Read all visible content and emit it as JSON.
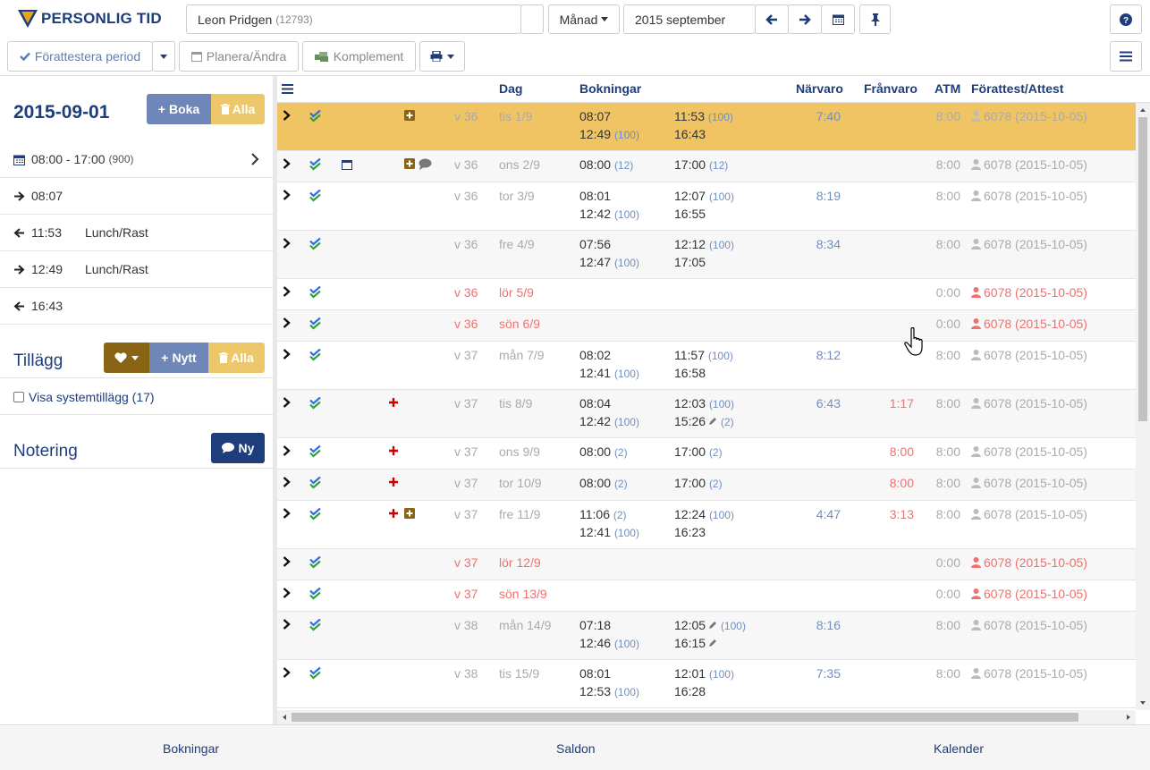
{
  "app": {
    "title": "PERSONLIG TID"
  },
  "toolbar": {
    "employee_name": "Leon Pridgen",
    "employee_id": "(12793)",
    "period_mode": "Månad",
    "period_value": "2015 september",
    "pre_attest_label": "Förattestera period",
    "plan_label": "Planera/Ändra",
    "complement_label": "Komplement"
  },
  "left": {
    "date": "2015-09-01",
    "book_label": "Boka",
    "all_label": "Alla",
    "schedule": "08:00 - 17:00",
    "schedule_code": "(900)",
    "punches": [
      {
        "dir": "in",
        "time": "08:07",
        "note": ""
      },
      {
        "dir": "out",
        "time": "11:53",
        "note": "Lunch/Rast"
      },
      {
        "dir": "in",
        "time": "12:49",
        "note": "Lunch/Rast"
      },
      {
        "dir": "out",
        "time": "16:43",
        "note": ""
      }
    ],
    "additions_title": "Tillägg",
    "new_label": "Nytt",
    "all_label2": "Alla",
    "show_system": "Visa systemtillägg (17)",
    "note_title": "Notering",
    "note_new": "Ny"
  },
  "grid": {
    "headers": [
      "Dag",
      "Bokningar",
      "Närvaro",
      "Frånvaro",
      "ATM",
      "Förattest/Attest"
    ],
    "rows": [
      {
        "week": "v 36",
        "day": "tis 1/9",
        "b1a": "08:07",
        "b1b": "",
        "b2a": "11:53",
        "b2b": "(100)",
        "b3a": "12:49",
        "b3b": "(100)",
        "b4a": "16:43",
        "b4b": "",
        "present": "7:40",
        "absent": "",
        "atm": "8:00",
        "attest": "6078 (2015-10-05)",
        "weekend": false,
        "highlight": true,
        "plus": false,
        "box": true,
        "cal": false,
        "comment": false
      },
      {
        "week": "v 36",
        "day": "ons 2/9",
        "b1a": "08:00",
        "b1b": "(12)",
        "b2a": "17:00",
        "b2b": "(12)",
        "b3a": "",
        "b3b": "",
        "b4a": "",
        "b4b": "",
        "present": "",
        "absent": "",
        "atm": "8:00",
        "attest": "6078 (2015-10-05)",
        "weekend": false,
        "highlight": false,
        "plus": false,
        "box": true,
        "cal": true,
        "comment": true
      },
      {
        "week": "v 36",
        "day": "tor 3/9",
        "b1a": "08:01",
        "b1b": "",
        "b2a": "12:07",
        "b2b": "(100)",
        "b3a": "12:42",
        "b3b": "(100)",
        "b4a": "16:55",
        "b4b": "",
        "present": "8:19",
        "absent": "",
        "atm": "8:00",
        "attest": "6078 (2015-10-05)",
        "weekend": false,
        "highlight": false,
        "plus": false,
        "box": false,
        "cal": false,
        "comment": false
      },
      {
        "week": "v 36",
        "day": "fre 4/9",
        "b1a": "07:56",
        "b1b": "",
        "b2a": "12:12",
        "b2b": "(100)",
        "b3a": "12:47",
        "b3b": "(100)",
        "b4a": "17:05",
        "b4b": "",
        "present": "8:34",
        "absent": "",
        "atm": "8:00",
        "attest": "6078 (2015-10-05)",
        "weekend": false,
        "highlight": false,
        "plus": false,
        "box": false,
        "cal": false,
        "comment": false
      },
      {
        "week": "v 36",
        "day": "lör 5/9",
        "b1a": "",
        "b1b": "",
        "b2a": "",
        "b2b": "",
        "b3a": "",
        "b3b": "",
        "b4a": "",
        "b4b": "",
        "present": "",
        "absent": "",
        "atm": "0:00",
        "attest": "6078 (2015-10-05)",
        "weekend": true,
        "highlight": false,
        "plus": false,
        "box": false,
        "cal": false,
        "comment": false
      },
      {
        "week": "v 36",
        "day": "sön 6/9",
        "b1a": "",
        "b1b": "",
        "b2a": "",
        "b2b": "",
        "b3a": "",
        "b3b": "",
        "b4a": "",
        "b4b": "",
        "present": "",
        "absent": "",
        "atm": "0:00",
        "attest": "6078 (2015-10-05)",
        "weekend": true,
        "highlight": false,
        "plus": false,
        "box": false,
        "cal": false,
        "comment": false
      },
      {
        "week": "v 37",
        "day": "mån 7/9",
        "b1a": "08:02",
        "b1b": "",
        "b2a": "11:57",
        "b2b": "(100)",
        "b3a": "12:41",
        "b3b": "(100)",
        "b4a": "16:58",
        "b4b": "",
        "present": "8:12",
        "absent": "",
        "atm": "8:00",
        "attest": "6078 (2015-10-05)",
        "weekend": false,
        "highlight": false,
        "plus": false,
        "box": false,
        "cal": false,
        "comment": false
      },
      {
        "week": "v 37",
        "day": "tis 8/9",
        "b1a": "08:04",
        "b1b": "",
        "b2a": "12:03",
        "b2b": "(100)",
        "b3a": "12:42",
        "b3b": "(100)",
        "b4a": "15:26",
        "b4b": "(2)",
        "present": "6:43",
        "absent": "1:17",
        "atm": "8:00",
        "attest": "6078 (2015-10-05)",
        "weekend": false,
        "highlight": false,
        "plus": true,
        "box": false,
        "cal": false,
        "comment": false,
        "pencil4": true
      },
      {
        "week": "v 37",
        "day": "ons 9/9",
        "b1a": "08:00",
        "b1b": "(2)",
        "b2a": "17:00",
        "b2b": "(2)",
        "b3a": "",
        "b3b": "",
        "b4a": "",
        "b4b": "",
        "present": "",
        "absent": "8:00",
        "atm": "8:00",
        "attest": "6078 (2015-10-05)",
        "weekend": false,
        "highlight": false,
        "plus": true,
        "box": false,
        "cal": false,
        "comment": false
      },
      {
        "week": "v 37",
        "day": "tor 10/9",
        "b1a": "08:00",
        "b1b": "(2)",
        "b2a": "17:00",
        "b2b": "(2)",
        "b3a": "",
        "b3b": "",
        "b4a": "",
        "b4b": "",
        "present": "",
        "absent": "8:00",
        "atm": "8:00",
        "attest": "6078 (2015-10-05)",
        "weekend": false,
        "highlight": false,
        "plus": true,
        "box": false,
        "cal": false,
        "comment": false
      },
      {
        "week": "v 37",
        "day": "fre 11/9",
        "b1a": "11:06",
        "b1b": "(2)",
        "b2a": "12:24",
        "b2b": "(100)",
        "b3a": "12:41",
        "b3b": "(100)",
        "b4a": "16:23",
        "b4b": "",
        "present": "4:47",
        "absent": "3:13",
        "atm": "8:00",
        "attest": "6078 (2015-10-05)",
        "weekend": false,
        "highlight": false,
        "plus": true,
        "box": true,
        "cal": false,
        "comment": false
      },
      {
        "week": "v 37",
        "day": "lör 12/9",
        "b1a": "",
        "b1b": "",
        "b2a": "",
        "b2b": "",
        "b3a": "",
        "b3b": "",
        "b4a": "",
        "b4b": "",
        "present": "",
        "absent": "",
        "atm": "0:00",
        "attest": "6078 (2015-10-05)",
        "weekend": true,
        "highlight": false,
        "plus": false,
        "box": false,
        "cal": false,
        "comment": false
      },
      {
        "week": "v 37",
        "day": "sön 13/9",
        "b1a": "",
        "b1b": "",
        "b2a": "",
        "b2b": "",
        "b3a": "",
        "b3b": "",
        "b4a": "",
        "b4b": "",
        "present": "",
        "absent": "",
        "atm": "0:00",
        "attest": "6078 (2015-10-05)",
        "weekend": true,
        "highlight": false,
        "plus": false,
        "box": false,
        "cal": false,
        "comment": false
      },
      {
        "week": "v 38",
        "day": "mån 14/9",
        "b1a": "07:18",
        "b1b": "",
        "b2a": "12:05",
        "b2b": "(100)",
        "b3a": "12:46",
        "b3b": "(100)",
        "b4a": "16:15",
        "b4b": "",
        "present": "8:16",
        "absent": "",
        "atm": "8:00",
        "attest": "6078 (2015-10-05)",
        "weekend": false,
        "highlight": false,
        "plus": false,
        "box": false,
        "cal": false,
        "comment": false,
        "pencil2": true,
        "pencil4": true
      },
      {
        "week": "v 38",
        "day": "tis 15/9",
        "b1a": "08:01",
        "b1b": "",
        "b2a": "12:01",
        "b2b": "(100)",
        "b3a": "12:53",
        "b3b": "(100)",
        "b4a": "16:28",
        "b4b": "",
        "present": "7:35",
        "absent": "",
        "atm": "8:00",
        "attest": "6078 (2015-10-05)",
        "weekend": false,
        "highlight": false,
        "plus": false,
        "box": false,
        "cal": false,
        "comment": false
      }
    ]
  },
  "footer": {
    "bookings": "Bokningar",
    "balances": "Saldon",
    "calendar": "Kalender"
  },
  "colors": {
    "brand": "#1e3d7b",
    "highlight": "#f0c463",
    "gold": "#8a6415",
    "steel": "#6f86b8",
    "amber": "#ecc86a"
  }
}
